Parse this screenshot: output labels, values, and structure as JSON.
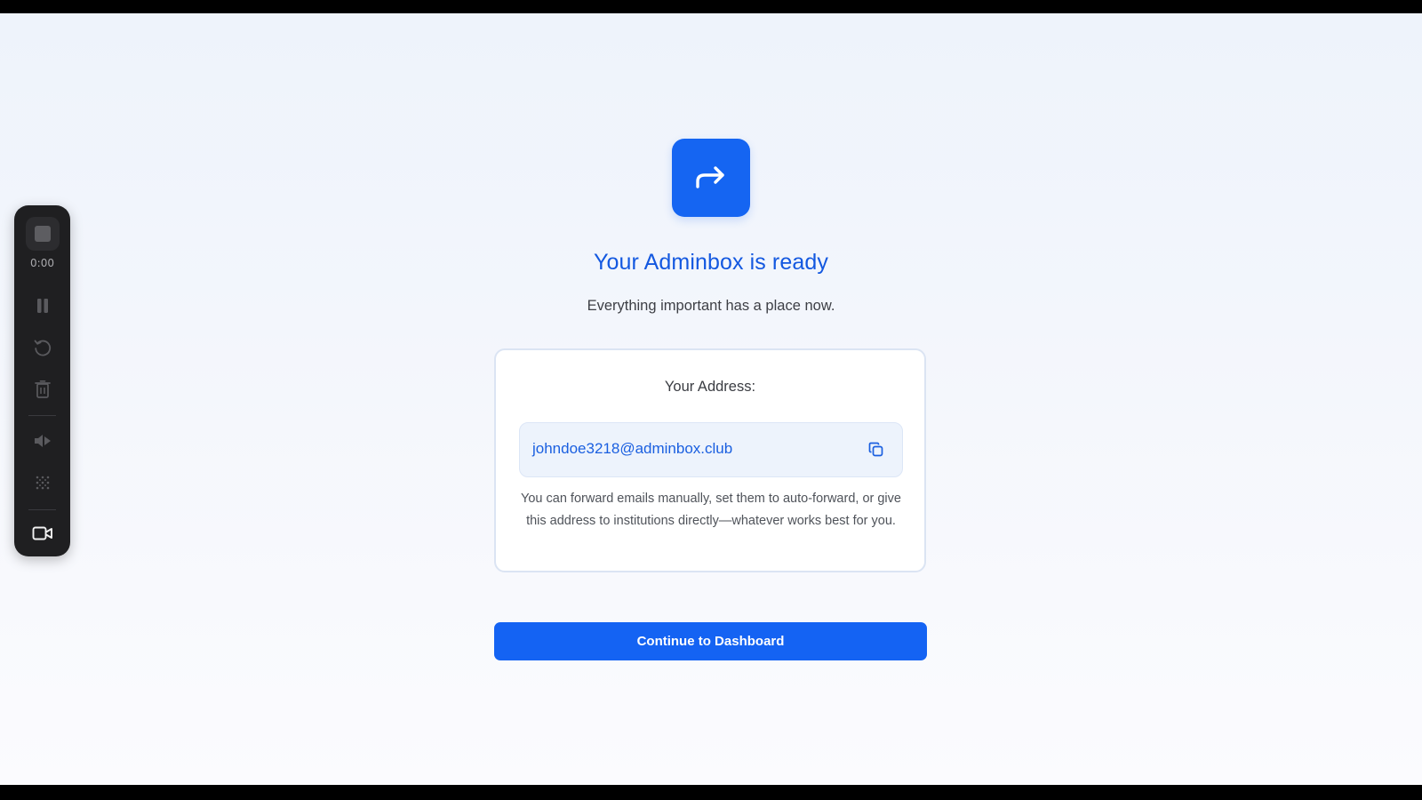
{
  "recorder": {
    "elapsed": "0:00"
  },
  "hero": {
    "icon": "forward-arrow-icon"
  },
  "heading": {
    "title": "Your Adminbox is ready",
    "subtitle": "Everything important has a place now."
  },
  "address_card": {
    "label": "Your Address:",
    "email": "johndoe3218@adminbox.club",
    "copy_icon": "copy-icon",
    "description": "You can forward emails manually, set them to auto-forward, or give this address to institutions directly—whatever works best for you."
  },
  "actions": {
    "continue_label": "Continue to Dashboard"
  },
  "colors": {
    "accent": "#1463f3",
    "title": "#1358e0",
    "address_bg": "#edf3fc",
    "recorder_bg": "#1f1f21"
  }
}
